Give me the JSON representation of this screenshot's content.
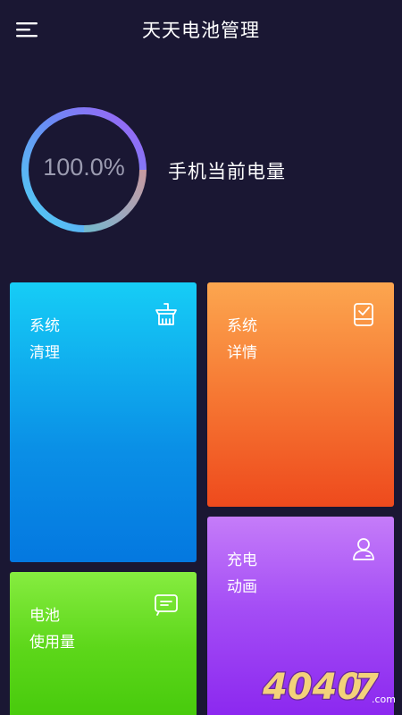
{
  "header": {
    "title": "天天电池管理",
    "menu_icon": "hamburger-menu-icon"
  },
  "battery": {
    "value_text": "100.0%",
    "level": 100,
    "label": "手机当前电量",
    "ring_colors": [
      "#5ad2f5",
      "#7a7cf4",
      "#a25ff5",
      "#c79aa0",
      "#7ab4c8"
    ]
  },
  "tiles": {
    "clean": {
      "line1": "系统",
      "line2": "清理",
      "icon": "broom-icon",
      "color": "#12b6f2"
    },
    "detail": {
      "line1": "系统",
      "line2": "详情",
      "icon": "device-check-icon",
      "color": "#f67833"
    },
    "animation": {
      "line1": "充电",
      "line2": "动画",
      "icon": "user-icon",
      "color": "#a44df5"
    },
    "usage": {
      "line1": "电池",
      "line2": "使用量",
      "icon": "message-icon",
      "color": "#5dd71a"
    }
  },
  "watermark": {
    "text": "4040",
    "suffix": "7",
    "domain": ".com"
  }
}
